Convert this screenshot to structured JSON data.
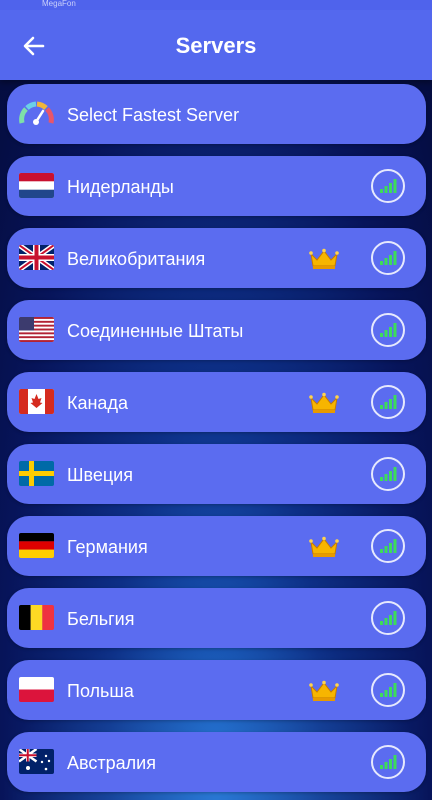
{
  "statusbar": {
    "carrier": "MegaFon"
  },
  "header": {
    "title": "Servers"
  },
  "fastest": {
    "label": "Select Fastest Server"
  },
  "servers": [
    {
      "id": "nl",
      "name": "Нидерланды",
      "premium": false
    },
    {
      "id": "gb",
      "name": "Великобритания",
      "premium": true
    },
    {
      "id": "us",
      "name": "Соединенные Штаты",
      "premium": false
    },
    {
      "id": "ca",
      "name": "Канада",
      "premium": true
    },
    {
      "id": "se",
      "name": "Швеция",
      "premium": false
    },
    {
      "id": "de",
      "name": "Германия",
      "premium": true
    },
    {
      "id": "be",
      "name": "Бельгия",
      "premium": false
    },
    {
      "id": "pl",
      "name": "Польша",
      "premium": true
    },
    {
      "id": "au",
      "name": "Австралия",
      "premium": false
    }
  ],
  "colors": {
    "row": "#5b6cf0",
    "appbar": "#5468ee",
    "signal": "#3ddc5a",
    "crown": "#f7b500"
  },
  "icons": {
    "back": "arrow-left-icon",
    "fastest": "speedometer-icon",
    "premium": "crown-icon",
    "signal": "signal-bars-icon"
  }
}
